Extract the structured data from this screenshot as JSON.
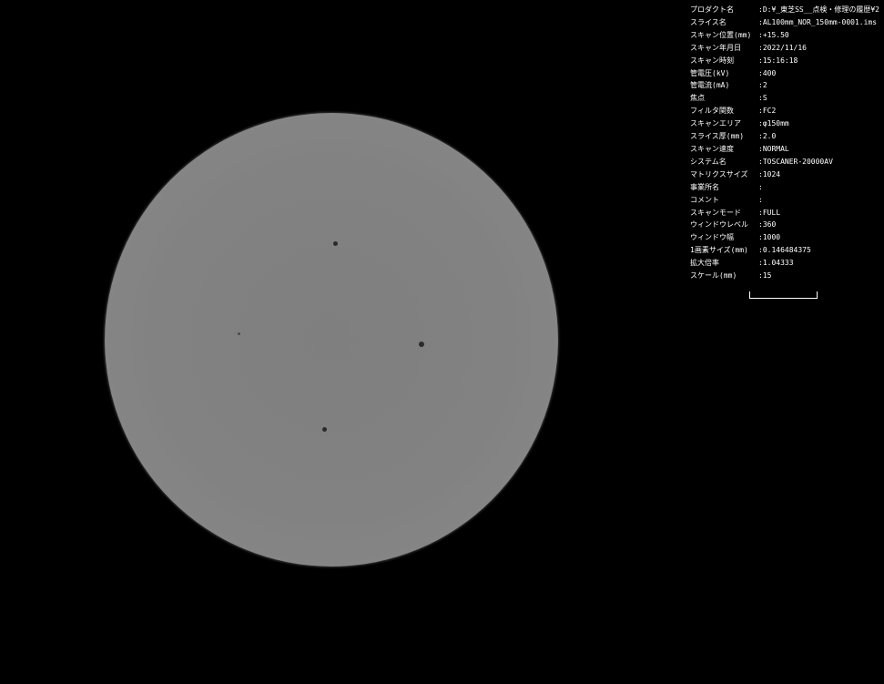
{
  "info_panel": {
    "rows": [
      {
        "label": "プロダクト名",
        "value": ":D:¥_東芝SS__点検・修理の履歴¥2"
      },
      {
        "label": "スライス名",
        "value": ":AL100mm_NOR_150mm-0001.ims"
      },
      {
        "label": "スキャン位置(mm)",
        "value": ":+15.50"
      },
      {
        "label": "スキャン年月日",
        "value": ":2022/11/16"
      },
      {
        "label": "スキャン時刻",
        "value": ":15:16:18"
      },
      {
        "label": "管電圧(kV)",
        "value": ":400"
      },
      {
        "label": "管電流(mA)",
        "value": ":2"
      },
      {
        "label": "焦点",
        "value": ":S"
      },
      {
        "label": "フィルタ関数",
        "value": ":FC2"
      },
      {
        "label": "スキャンエリア",
        "value": ":φ150mm"
      },
      {
        "label": "スライス厚(mm)",
        "value": ":2.0"
      },
      {
        "label": "スキャン速度",
        "value": ":NORMAL"
      },
      {
        "label": "システム名",
        "value": ":TOSCANER-20000AV"
      },
      {
        "label": "マトリクスサイズ",
        "value": ":1024"
      },
      {
        "label": "事業所名",
        "value": ":"
      },
      {
        "label": "コメント",
        "value": ":"
      },
      {
        "label": "スキャンモード",
        "value": ":FULL"
      },
      {
        "label": "ウィンドウレベル",
        "value": ":360"
      },
      {
        "label": "ウィンドウ幅",
        "value": ":1000"
      },
      {
        "label": "1画素サイズ(mm)",
        "value": ":0.146484375"
      },
      {
        "label": "拡大倍率",
        "value": ":1.04333"
      },
      {
        "label": "スケール(mm)",
        "value": ":15"
      }
    ]
  },
  "colors": {
    "background": "#000000",
    "text": "#ffffff",
    "specimen": "#828282",
    "pore": "#2a2a2a"
  }
}
